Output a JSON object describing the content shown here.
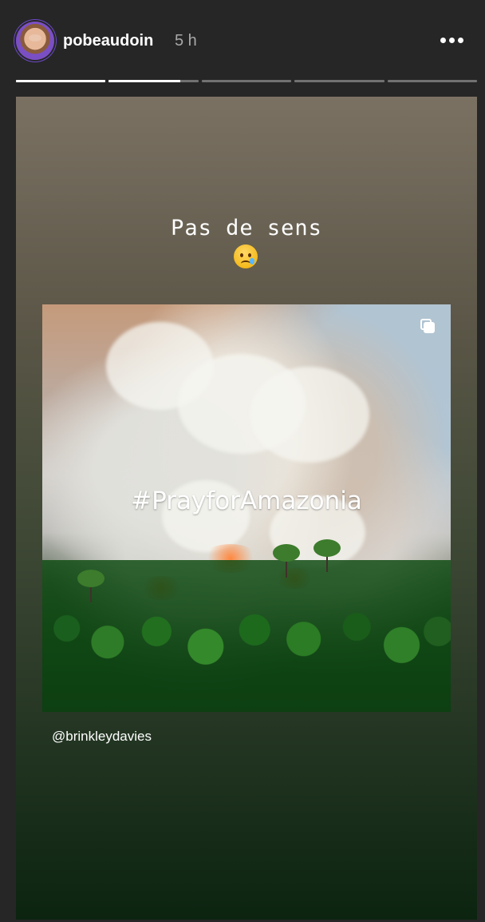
{
  "header": {
    "username": "pobeaudoin",
    "time": "5 h",
    "more_icon": "ellipsis-icon"
  },
  "progress": {
    "segments": [
      1,
      0.8,
      0,
      0,
      0
    ]
  },
  "story": {
    "caption": "Pas de sens",
    "emoji_icon": "crying-face-icon",
    "image_overlay_text": "#PrayforAmazonia",
    "multi_photo_icon": "multiple-images-icon",
    "mention": "@brinkleydavies"
  },
  "colors": {
    "background": "#262626",
    "accent": "#7b4fc4",
    "text": "#ffffff",
    "muted_text": "#a8a8a8"
  }
}
